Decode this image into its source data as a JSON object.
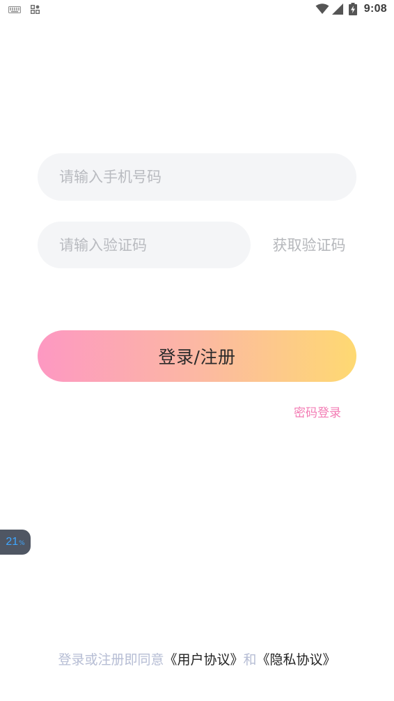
{
  "status_bar": {
    "left_icons": [
      "keyboard-icon",
      "grid-icon"
    ],
    "right_icons": [
      "wifi-icon",
      "signal-icon",
      "battery-charging-icon"
    ],
    "time": "9:08"
  },
  "form": {
    "phone_placeholder": "请输入手机号码",
    "code_placeholder": "请输入验证码",
    "get_code_label": "获取验证码",
    "submit_label": "登录/注册",
    "password_login_label": "密码登录"
  },
  "float_badge": {
    "value": "21",
    "unit": "%"
  },
  "agreement": {
    "prefix": "登录或注册即同意",
    "user_agreement": "《用户协议》",
    "conjunction": "和",
    "privacy_policy": "《隐私协议》"
  },
  "colors": {
    "gradient_start": "#fd98c2",
    "gradient_end": "#fed972",
    "accent_pink": "#f37cb4",
    "field_bg": "#f4f5f7",
    "agreement_muted": "#b6bdd4"
  }
}
